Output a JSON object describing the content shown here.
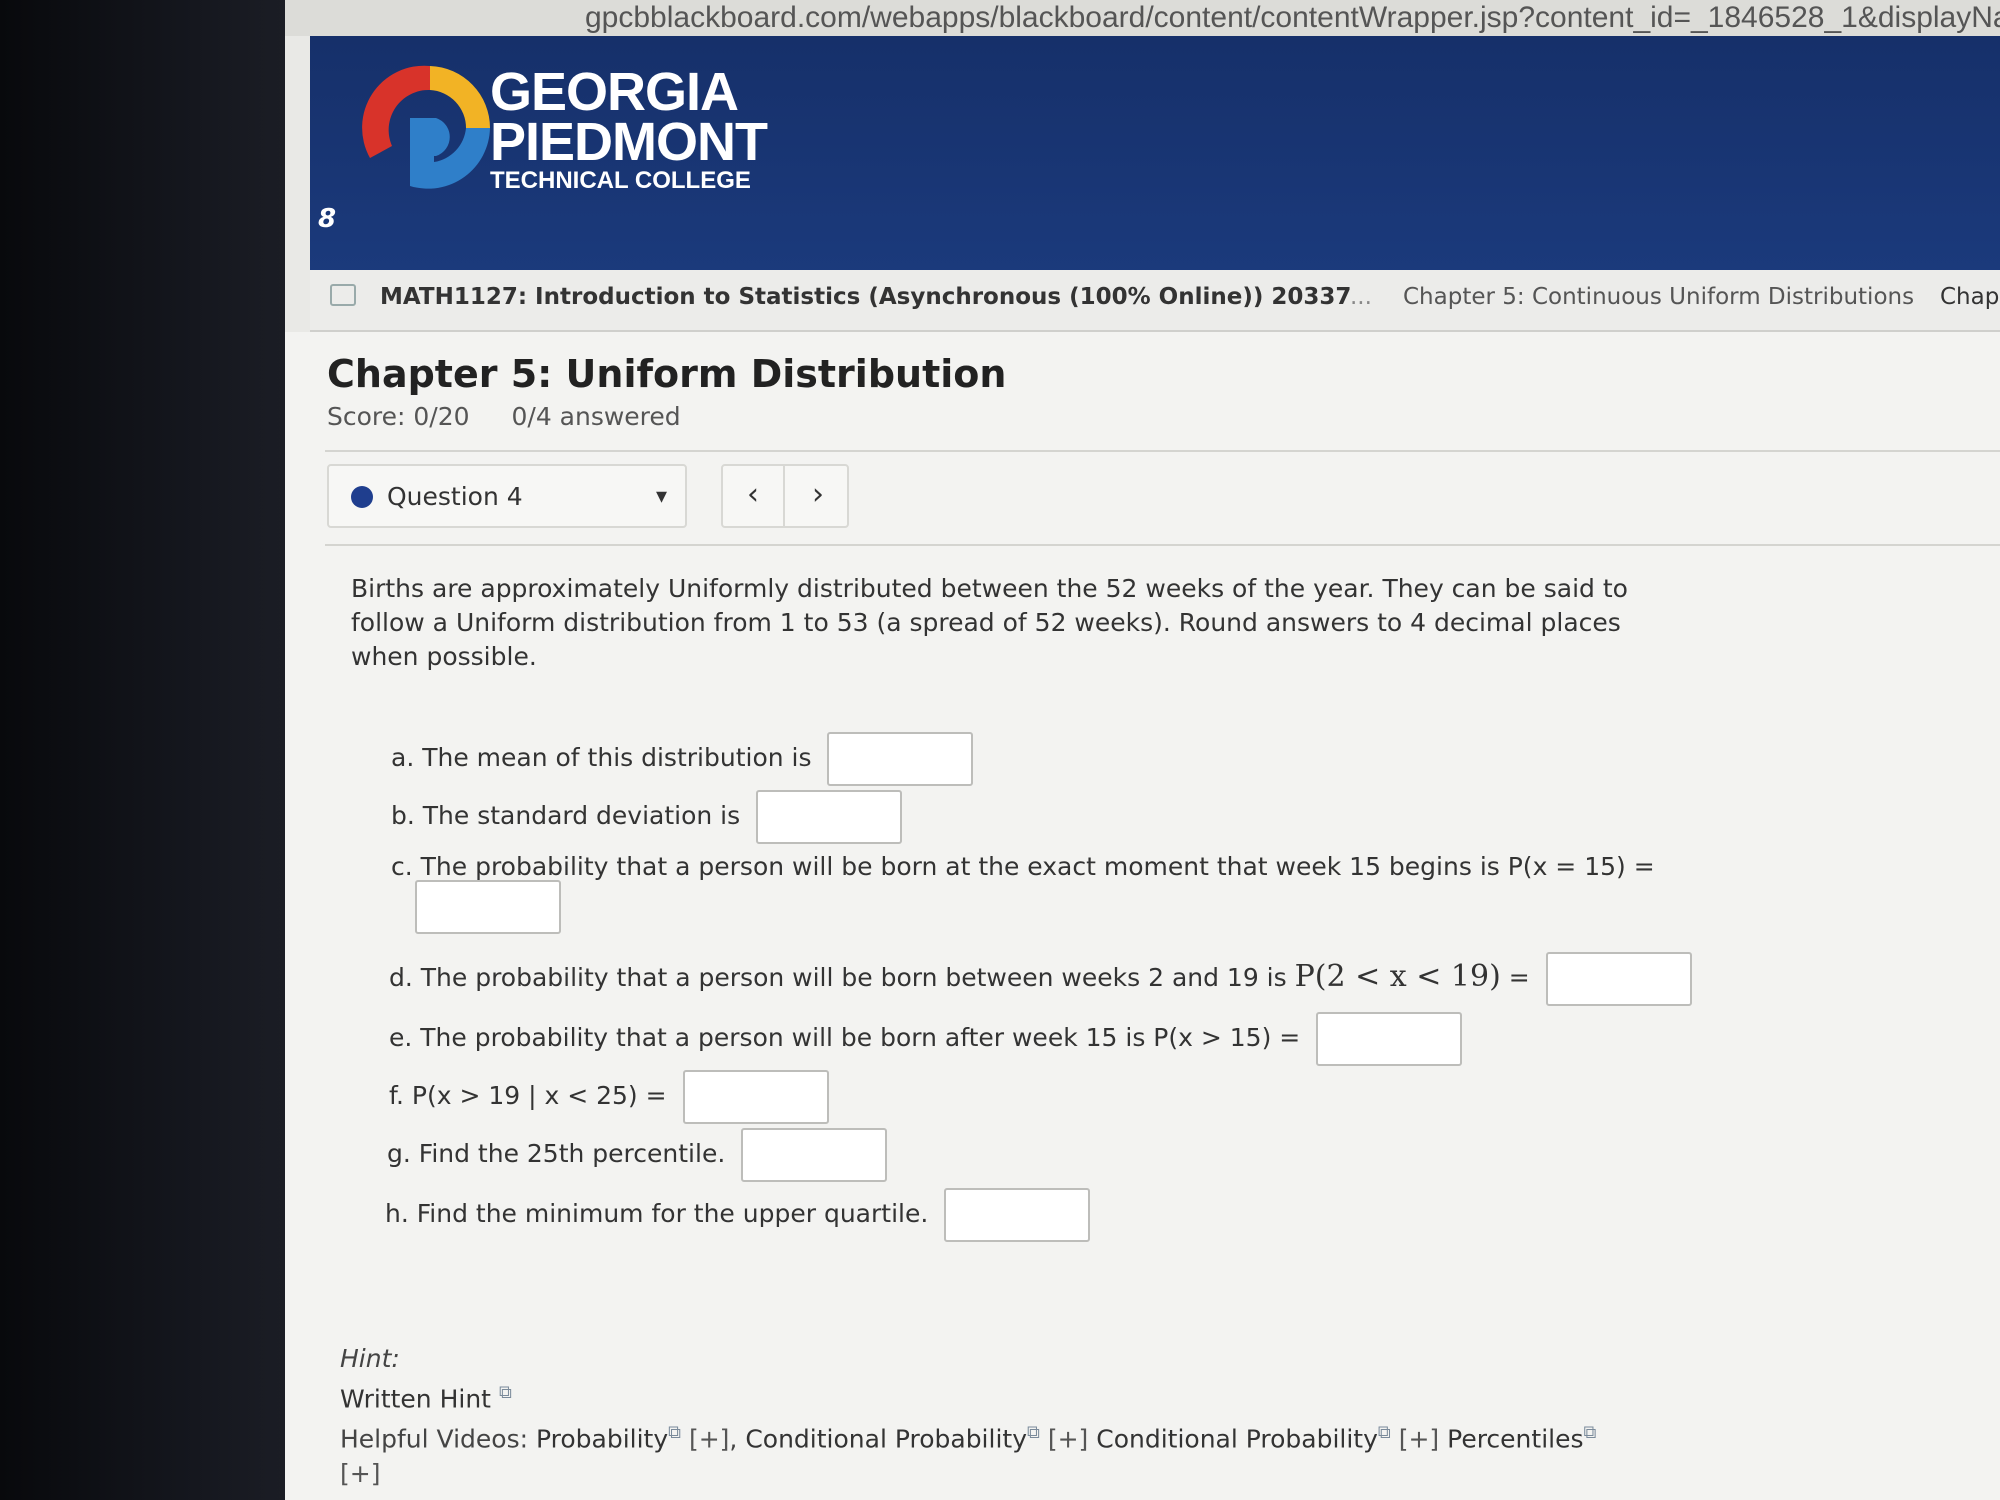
{
  "browser": {
    "url": "gpcbblackboard.com/webapps/blackboard/content/contentWrapper.jsp?content_id=_1846528_1&displayNam"
  },
  "header": {
    "logo_line1": "GEORGIA",
    "logo_line2": "PIEDMONT",
    "logo_line3": "TECHNICAL COLLEGE",
    "menu_glyph": "8"
  },
  "breadcrumb": {
    "course": "MATH1127: Introduction to Statistics (Asynchronous (100% Online)) 20337",
    "ellipsis": "...",
    "chapter": "Chapter 5: Continuous Uniform Distributions",
    "chapter_cut": "Chapter"
  },
  "assignment": {
    "title": "Chapter 5: Uniform Distribution",
    "score": "Score: 0/20",
    "answered": "0/4 answered"
  },
  "question_nav": {
    "selected": "Question 4",
    "caret": "▾",
    "prev": "‹",
    "next": "›"
  },
  "problem": {
    "text": "Births are approximately Uniformly distributed between the 52 weeks of the year. They can be said to follow a Uniform distribution from 1 to 53 (a spread of 52 weeks). Round answers to 4 decimal places when possible.",
    "parts": {
      "a": "a. The mean of this distribution is",
      "b": "b. The standard deviation is",
      "c": "c. The probability that a person will be born at the exact moment that week 15 begins is P(x = 15) =",
      "d_prefix": "d. The probability that a person will be born between weeks 2 and 19 is",
      "d_math": "P(2 < x < 19)",
      "d_eq": "=",
      "e": "e. The probability that a person will be born after week 15 is P(x > 15) =",
      "f": "f. P(x > 19 | x < 25) =",
      "g": "g. Find the 25th percentile.",
      "h": "h. Find the minimum for the upper quartile."
    }
  },
  "hint": {
    "title": "Hint:",
    "written": "Written Hint",
    "videos_prefix": "Helpful Videos:",
    "video1": "Probability",
    "video2": "Conditional Probability",
    "video3": "Conditional Probability",
    "video4": "Percentiles",
    "plus": "[+]",
    "comma": ","
  }
}
